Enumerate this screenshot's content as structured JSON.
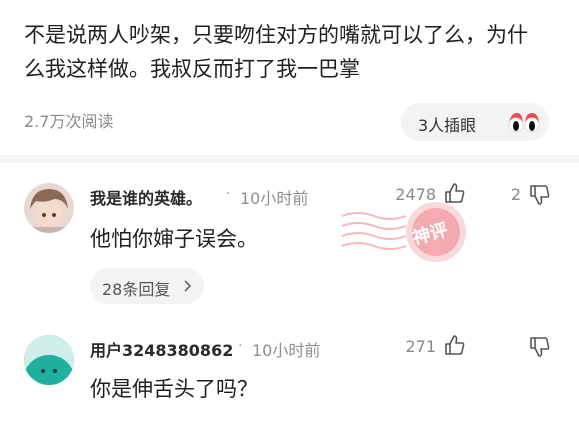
{
  "post": {
    "title": "不是说两人吵架，只要吻住对方的嘴就可以了么，为什么我这样做。我叔反而打了我一巴掌",
    "reads": "2.7万次阅读",
    "plug_label": "3人插眼",
    "plug_icon": "eyes-icon"
  },
  "comments": [
    {
      "name": "我是谁的英雄。",
      "separator": "·",
      "time": "10小时前",
      "likes": "2478",
      "dislikes": "2",
      "body": "他怕你婶子误会。",
      "replies_label": "28条回复"
    },
    {
      "name": "用户3248380862",
      "separator": "·",
      "time": "10小时前",
      "likes": "271",
      "dislikes": "",
      "body": "你是伸舌头了吗？"
    }
  ],
  "stamp": {
    "text": "神评"
  },
  "colors": {
    "stamp": "#e8606a",
    "divider": "#f4f4f4",
    "pill": "#f3f3f3",
    "avatar2": "#1fb0a0"
  }
}
